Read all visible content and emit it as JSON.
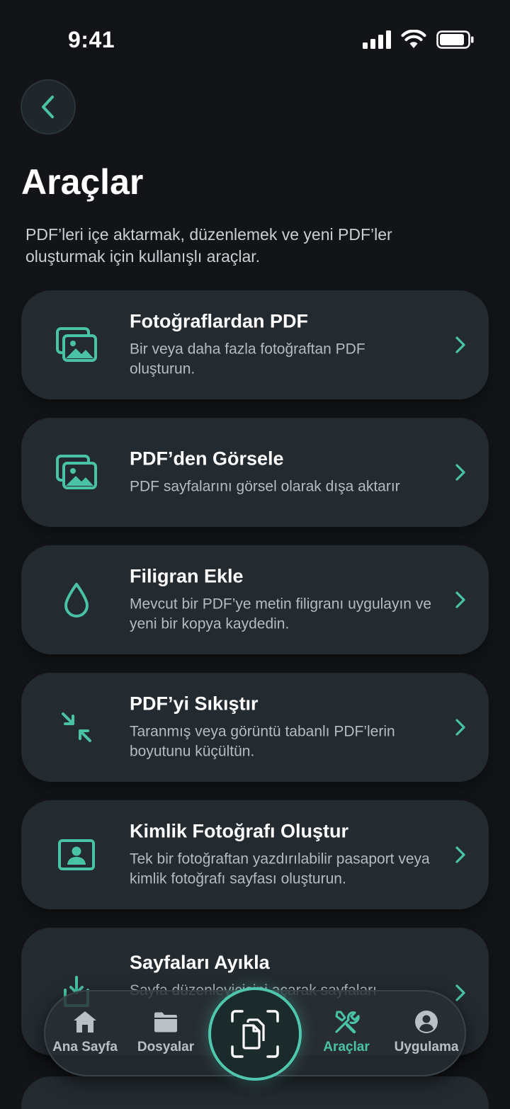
{
  "status_bar": {
    "time": "9:41"
  },
  "header": {
    "title": "Araçlar",
    "subtitle": "PDF’leri içe aktarmak, düzenlemek ve yeni PDF’ler oluşturmak için kullanışlı araçlar."
  },
  "tools": [
    {
      "title": "Fotoğraflardan PDF",
      "desc": "Bir veya daha fazla fotoğraftan PDF oluşturun.",
      "icon": "images-icon"
    },
    {
      "title": "PDF’den Görsele",
      "desc": "PDF sayfalarını görsel olarak dışa aktarır",
      "icon": "images-icon"
    },
    {
      "title": "Filigran Ekle",
      "desc": "Mevcut bir PDF’ye metin filigranı uygulayın ve yeni bir kopya kaydedin.",
      "icon": "droplet-icon"
    },
    {
      "title": "PDF’yi Sıkıştır",
      "desc": "Taranmış veya görüntü tabanlı PDF’lerin boyutunu küçültün.",
      "icon": "compress-icon"
    },
    {
      "title": "Kimlik Fotoğrafı Oluştur",
      "desc": "Tek bir fotoğraftan yazdırılabilir pasaport veya kimlik fotoğrafı sayfası oluşturun.",
      "icon": "id-photo-icon"
    },
    {
      "title": "Sayfaları Ayıkla",
      "desc": "Sayfa düzenleyicisini açarak sayfaları",
      "icon": "extract-icon"
    }
  ],
  "nav": {
    "items": [
      {
        "label": "Ana Sayfa",
        "icon": "home-icon"
      },
      {
        "label": "Dosyalar",
        "icon": "folder-icon"
      },
      {
        "label": "Araçlar",
        "icon": "tools-icon",
        "active": true
      },
      {
        "label": "Uygulama",
        "icon": "user-icon"
      }
    ],
    "fab_icon": "scan-document-icon"
  },
  "colors": {
    "accent": "#49c2a6",
    "background": "#121417",
    "card": "#232a30"
  }
}
